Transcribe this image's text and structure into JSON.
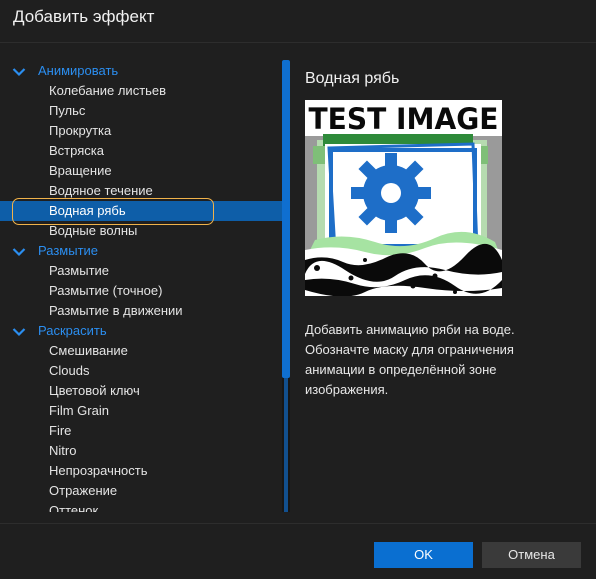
{
  "dialog": {
    "title": "Добавить эффект",
    "ok_label": "OK",
    "cancel_label": "Отмена"
  },
  "tree": [
    {
      "type": "group",
      "label": "Анимировать"
    },
    {
      "type": "item",
      "label": "Колебание листьев"
    },
    {
      "type": "item",
      "label": "Пульс"
    },
    {
      "type": "item",
      "label": "Прокрутка"
    },
    {
      "type": "item",
      "label": "Встряска"
    },
    {
      "type": "item",
      "label": "Вращение"
    },
    {
      "type": "item",
      "label": "Водяное течение"
    },
    {
      "type": "item",
      "label": "Водная рябь",
      "selected": true
    },
    {
      "type": "item",
      "label": "Водные волны"
    },
    {
      "type": "group",
      "label": "Размытие"
    },
    {
      "type": "item",
      "label": "Размытие"
    },
    {
      "type": "item",
      "label": "Размытие (точное)"
    },
    {
      "type": "item",
      "label": "Размытие в движении"
    },
    {
      "type": "group",
      "label": "Раскрасить"
    },
    {
      "type": "item",
      "label": "Смешивание"
    },
    {
      "type": "item",
      "label": "Clouds"
    },
    {
      "type": "item",
      "label": "Цветовой ключ"
    },
    {
      "type": "item",
      "label": "Film Grain"
    },
    {
      "type": "item",
      "label": "Fire"
    },
    {
      "type": "item",
      "label": "Nitro"
    },
    {
      "type": "item",
      "label": "Непрозрачность"
    },
    {
      "type": "item",
      "label": "Отражение"
    },
    {
      "type": "item",
      "label": "Оттенок"
    }
  ],
  "preview": {
    "title": "Водная рябь",
    "image_text": "TEST IMAGE",
    "description": "Добавить анимацию ряби на воде. Обозначте маску для ограничения анимации в определённой зоне изображения."
  },
  "colors": {
    "accent": "#0a6fd1",
    "selected_row": "#0e5ea8",
    "focus_ring": "#f0b24a",
    "group_text": "#2b8ef0"
  }
}
